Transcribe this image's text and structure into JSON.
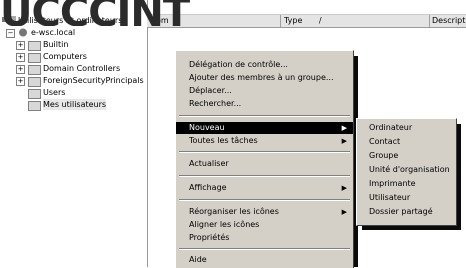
{
  "logo_text": "UCCCINTY",
  "tree": {
    "root": "Utilisateurs et ordinateurs",
    "domain": "e-wsc.local",
    "expander_plus": "+",
    "expander_minus": "−",
    "items": [
      {
        "label": "Builtin"
      },
      {
        "label": "Computers"
      },
      {
        "label": "Domain Controllers"
      },
      {
        "label": "ForeignSecurityPrincipals"
      },
      {
        "label": "Users"
      },
      {
        "label": "Mes utilisateurs"
      }
    ]
  },
  "list_header": {
    "columns": [
      "Nom",
      "Type",
      "Description"
    ],
    "sort_indicator": "/"
  },
  "context_menu": {
    "items": [
      {
        "label": "Délégation de contrôle..."
      },
      {
        "label": "Ajouter des membres à un groupe..."
      },
      {
        "label": "Déplacer..."
      },
      {
        "label": "Rechercher..."
      },
      {
        "label": "Nouveau",
        "arrow": "▶"
      },
      {
        "label": "Toutes les tâches",
        "arrow": "▶"
      },
      {
        "label": "Actualiser"
      },
      {
        "label": "Affichage",
        "arrow": "▶"
      },
      {
        "label": "Réorganiser les icônes",
        "arrow": "▶"
      },
      {
        "label": "Aligner les icônes"
      },
      {
        "label": "Propriétés"
      },
      {
        "label": "Aide"
      }
    ]
  },
  "submenu_new": {
    "items": [
      {
        "label": "Ordinateur"
      },
      {
        "label": "Contact"
      },
      {
        "label": "Groupe"
      },
      {
        "label": "Unité d'organisation"
      },
      {
        "label": "Imprimante"
      },
      {
        "label": "Utilisateur"
      },
      {
        "label": "Dossier partagé"
      }
    ]
  }
}
